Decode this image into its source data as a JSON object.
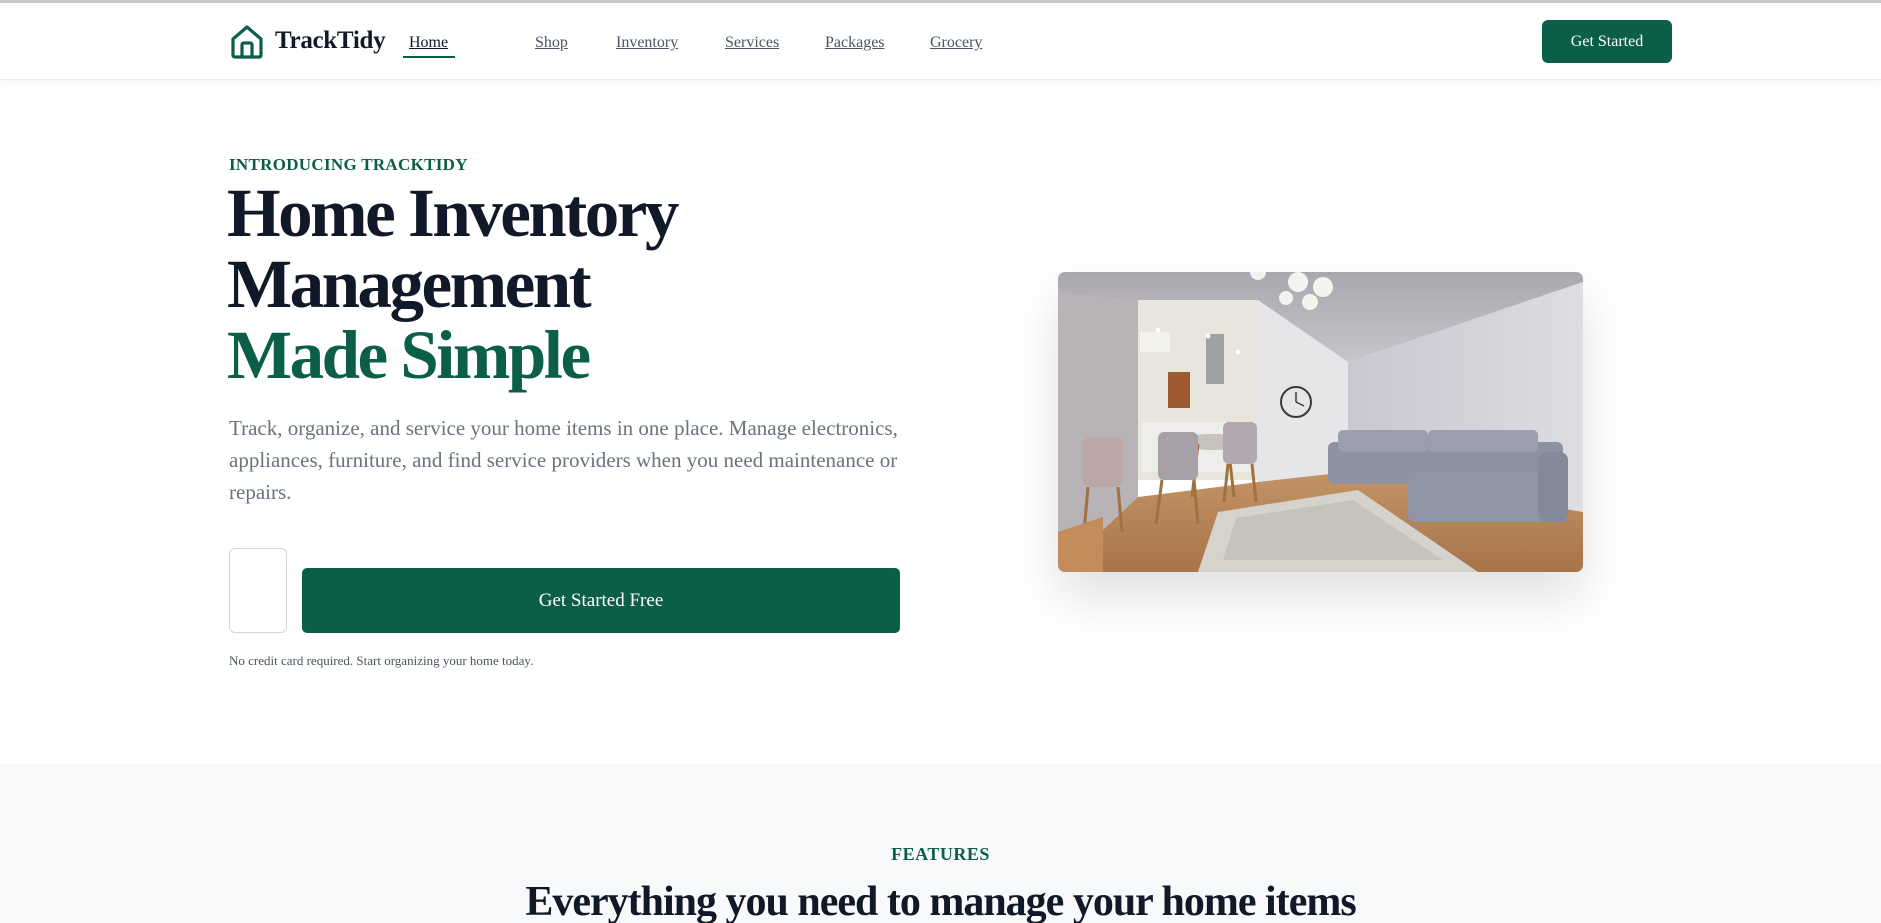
{
  "header": {
    "brand_name": "TrackTidy",
    "nav": [
      {
        "label": "Home",
        "active": true
      },
      {
        "label": "Shop"
      },
      {
        "label": "Inventory"
      },
      {
        "label": "Services"
      },
      {
        "label": "Packages"
      },
      {
        "label": "Grocery"
      }
    ],
    "cta_label": "Get Started"
  },
  "hero": {
    "eyebrow": "INTRODUCING TRACKTIDY",
    "title_line1": "Home Inventory",
    "title_line2": "Management",
    "title_accent": "Made Simple",
    "description": "Track, organize, and service your home items in one place. Manage electronics, appliances, furniture, and find service providers when you need maintenance or repairs.",
    "email_value": "",
    "cta_label": "Get Started Free",
    "fine_print": "No credit card required. Start organizing your home today."
  },
  "features": {
    "eyebrow": "FEATURES",
    "title": "Everything you need to manage your home items"
  },
  "colors": {
    "brand": "#0b5e47",
    "heading": "#111827",
    "muted": "#6b7280",
    "section_bg": "#f8f9fa"
  },
  "icons": {
    "logo": "house-icon"
  }
}
